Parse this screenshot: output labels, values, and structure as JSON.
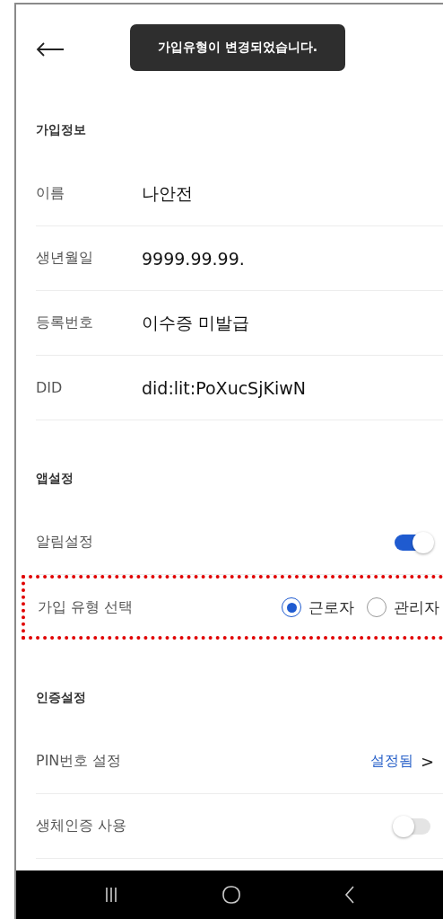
{
  "toast": "가입유형이 변경되었습니다.",
  "sections": [
    {
      "title": "가입정보",
      "rows": [
        {
          "kind": "info",
          "label": "이름",
          "value": "나안전"
        },
        {
          "kind": "info",
          "label": "생년월일",
          "value": "9999.99.99."
        },
        {
          "kind": "info",
          "label": "등록번호",
          "value": "이수증 미발급"
        },
        {
          "kind": "info",
          "label": "DID",
          "value": "did:lit:PoXucSjKiwN"
        }
      ]
    },
    {
      "title": "앱설정",
      "rows": [
        {
          "kind": "toggle",
          "label": "알림설정",
          "on": true
        },
        {
          "kind": "radio",
          "label": "가입 유형 선택",
          "highlighted": true,
          "options": [
            {
              "label": "근로자",
              "selected": true
            },
            {
              "label": "관리자",
              "selected": false
            }
          ]
        }
      ]
    },
    {
      "title": "인증설정",
      "rows": [
        {
          "kind": "link",
          "label": "PIN번호 설정",
          "value": "설정됨",
          "chevron": ">"
        },
        {
          "kind": "toggle",
          "label": "생체인증 사용",
          "on": false
        }
      ]
    }
  ]
}
